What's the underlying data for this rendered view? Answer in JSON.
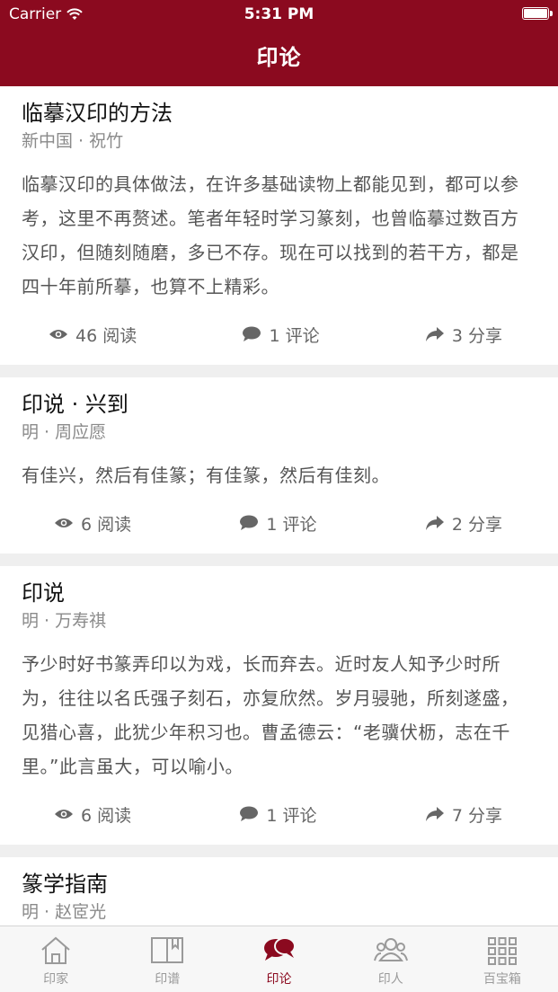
{
  "status_bar": {
    "carrier": "Carrier",
    "time": "5:31 PM"
  },
  "header": {
    "title": "印论"
  },
  "articles": [
    {
      "title": "临摹汉印的方法",
      "author": "新中国 · 祝竹",
      "excerpt": "临摹汉印的具体做法，在许多基础读物上都能见到，都可以参考，这里不再赘述。笔者年轻时学习篆刻，也曾临摹过数百方汉印，但随刻随磨，多已不存。现在可以找到的若干方，都是四十年前所摹，也算不上精彩。",
      "reads": "46 阅读",
      "comments": "1 评论",
      "shares": "3 分享"
    },
    {
      "title": "印说 · 兴到",
      "author": "明 · 周应愿",
      "excerpt": "有佳兴，然后有佳篆；有佳篆，然后有佳刻。",
      "reads": "6 阅读",
      "comments": "1 评论",
      "shares": "2 分享"
    },
    {
      "title": "印说",
      "author": "明 · 万寿祺",
      "excerpt": "予少时好书篆弄印以为戏，长而弃去。近时友人知予少时所为，往往以名氏强子刻石，亦复欣然。岁月骎驰，所刻遂盛，见猎心喜，此犹少年积习也。曹孟德云：“老骥伏枥，志在千里。”此言虽大，可以喻小。",
      "reads": "6 阅读",
      "comments": "1 评论",
      "shares": "7 分享"
    },
    {
      "title": "篆学指南",
      "author": "明 · 赵宧光",
      "excerpt": "",
      "reads": "",
      "comments": "",
      "shares": ""
    }
  ],
  "tabbar": {
    "items": [
      {
        "label": "印家",
        "icon": "house-icon"
      },
      {
        "label": "印谱",
        "icon": "book-icon"
      },
      {
        "label": "印论",
        "icon": "chat-bubbles-icon",
        "active": true
      },
      {
        "label": "印人",
        "icon": "people-icon"
      },
      {
        "label": "百宝箱",
        "icon": "grid-icon"
      }
    ]
  },
  "colors": {
    "brand": "#8b0a1f",
    "background": "#efefef",
    "card": "#ffffff",
    "muted_text": "#8a8a8a"
  }
}
